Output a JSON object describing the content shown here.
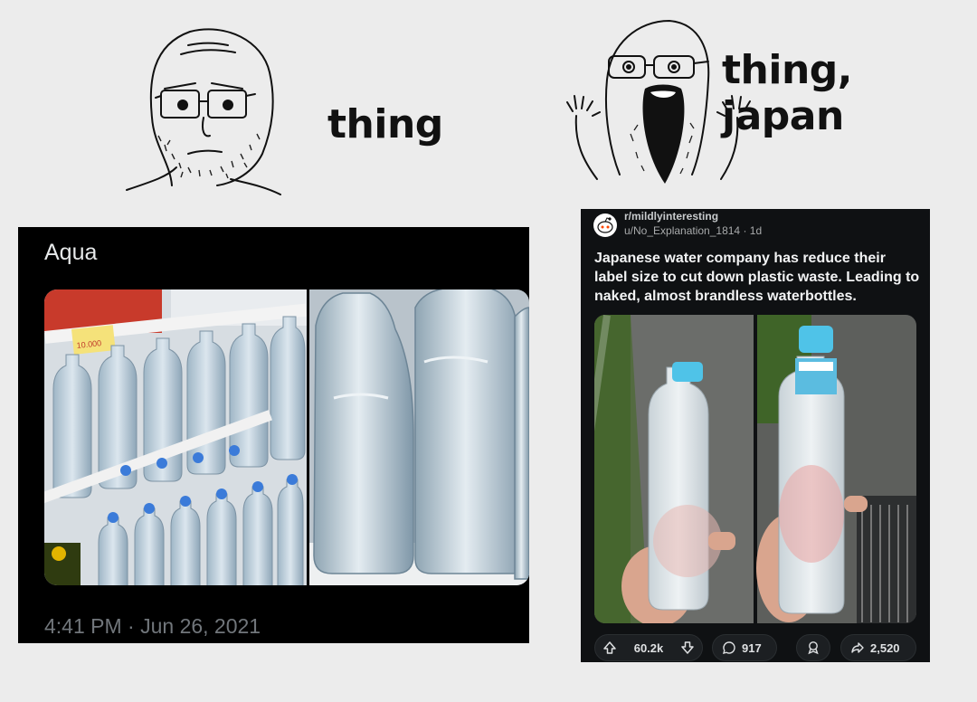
{
  "meme": {
    "left_caption": "thing",
    "right_caption": "thing, japan"
  },
  "tweet": {
    "author": "Aqua",
    "timestamp": "4:41 PM · Jun 26, 2021",
    "price_tag": "10.000"
  },
  "reddit": {
    "subreddit": "r/mildlyinteresting",
    "user": "u/No_Explanation_1814",
    "age": "1d",
    "separator": "·",
    "title": "Japanese water company has reduce their label size to cut down plastic waste. Leading to naked, almost brandless waterbottles.",
    "upvotes": "60.2k",
    "comments": "917",
    "shares": "2,520"
  },
  "colors": {
    "background": "#ececec",
    "tweet_bg": "#000000",
    "reddit_bg": "#0f1113",
    "bottle_cap_blue": "#3b7bd9",
    "cap_cyan": "#4fc3e8"
  },
  "icons": [
    "upvote-icon",
    "downvote-icon",
    "comment-icon",
    "award-icon",
    "share-icon",
    "reddit-snoo-icon"
  ]
}
